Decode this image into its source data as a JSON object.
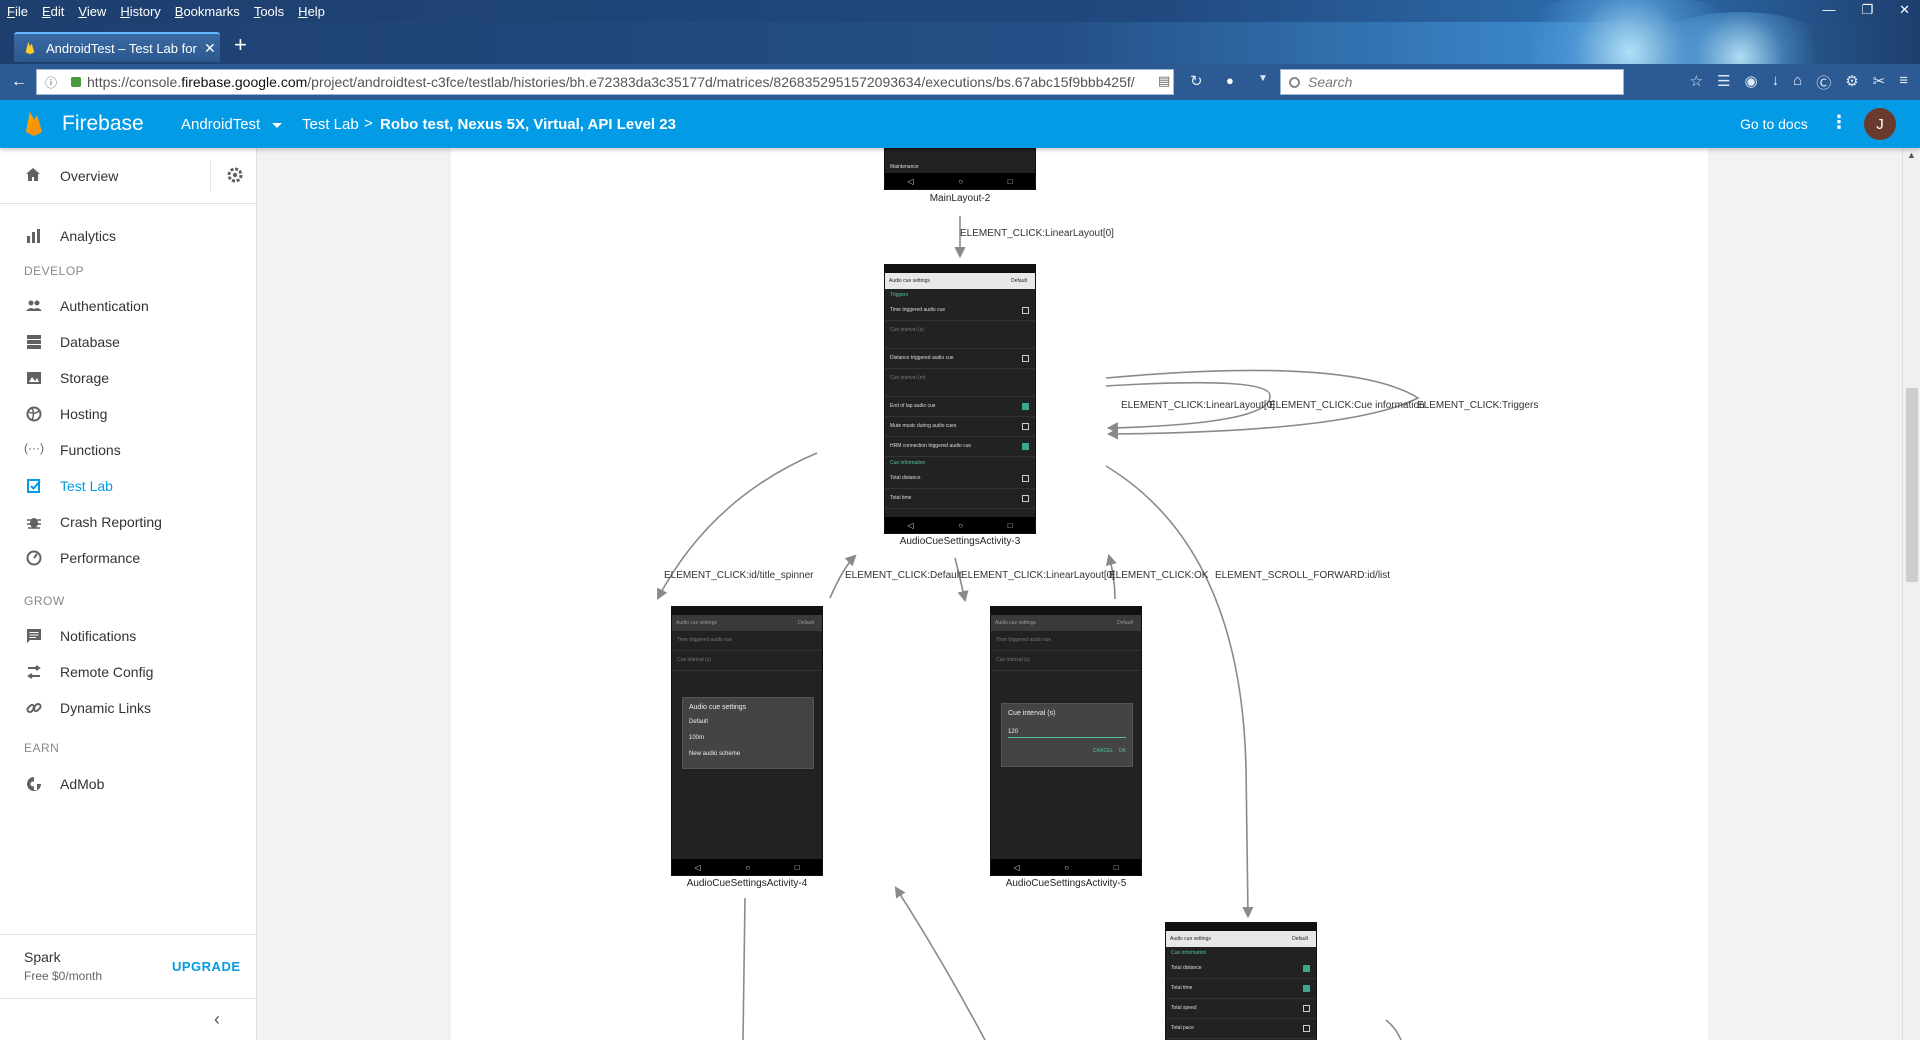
{
  "browser": {
    "menu": [
      "File",
      "Edit",
      "View",
      "History",
      "Bookmarks",
      "Tools",
      "Help"
    ],
    "tab_title": "AndroidTest – Test Lab for A",
    "url_prefix": "https://console.",
    "url_domain": "firebase.google.com",
    "url_rest": "/project/androidtest-c3fce/testlab/histories/bh.e72383da3c35177d/matrices/8268352951572093634/executions/bs.67abc15f9bbb425f/",
    "search_placeholder": "Search"
  },
  "header": {
    "brand": "Firebase",
    "project": "AndroidTest",
    "crumb": "Test Lab",
    "separator": ">",
    "current": "Robo test, Nexus 5X, Virtual, API Level 23",
    "docs": "Go to docs",
    "avatar_letter": "J",
    "accent": "#039be5"
  },
  "sidebar": {
    "overview": "Overview",
    "analytics": "Analytics",
    "develop_label": "DEVELOP",
    "develop": [
      "Authentication",
      "Database",
      "Storage",
      "Hosting",
      "Functions",
      "Test Lab",
      "Crash Reporting",
      "Performance"
    ],
    "grow_label": "GROW",
    "grow": [
      "Notifications",
      "Remote Config",
      "Dynamic Links"
    ],
    "earn_label": "EARN",
    "earn": [
      "AdMob"
    ],
    "plan_name": "Spark",
    "plan_price": "Free $0/month",
    "upgrade": "UPGRADE"
  },
  "graph": {
    "captions": {
      "main": "MainLayout-2",
      "s3": "AudioCueSettingsActivity-3",
      "s4": "AudioCueSettingsActivity-4",
      "s5": "AudioCueSettingsActivity-5"
    },
    "edges": {
      "e1": "ELEMENT_CLICK:LinearLayout[0]",
      "e2": "ELEMENT_CLICK:LinearLayout[0]",
      "e3": "ELEMENT_CLICK:Cue information",
      "e4": "ELEMENT_CLICK:Triggers",
      "e5": "ELEMENT_CLICK:id/title_spinner",
      "e6": "ELEMENT_CLICK:Default",
      "e7": "ELEMENT_CLICK:LinearLayout[0]",
      "e8": "ELEMENT_CLICK:OK",
      "e9": "ELEMENT_SCROLL_FORWARD:id/list"
    },
    "screen3": {
      "title": "Audio cue settings",
      "dropdown": "Default",
      "triggers": "Triggers",
      "rows": [
        "Time triggered audio cue",
        "Cue interval (s)",
        "Distance triggered audio cue",
        "Cue interval (m)",
        "End of lap audio cue",
        "Mute music during audio cues",
        "HRM connection triggered audio cue"
      ],
      "cue_info": "Cue information",
      "rows2": [
        "Total distance",
        "Total time"
      ]
    },
    "screen4_dialog": {
      "title": "Audio cue settings",
      "options": [
        "Default",
        "100m",
        "New audio scheme"
      ]
    },
    "screen5_dialog": {
      "title": "Cue interval (s)",
      "value": "120",
      "cancel": "CANCEL",
      "ok": "OK"
    },
    "screen6": {
      "title": "Audio cue settings",
      "dropdown": "Default",
      "header": "Cue information",
      "rows": [
        "Total distance",
        "Total time",
        "Total speed",
        "Total pace"
      ]
    },
    "main_partial": "Maintenance"
  }
}
